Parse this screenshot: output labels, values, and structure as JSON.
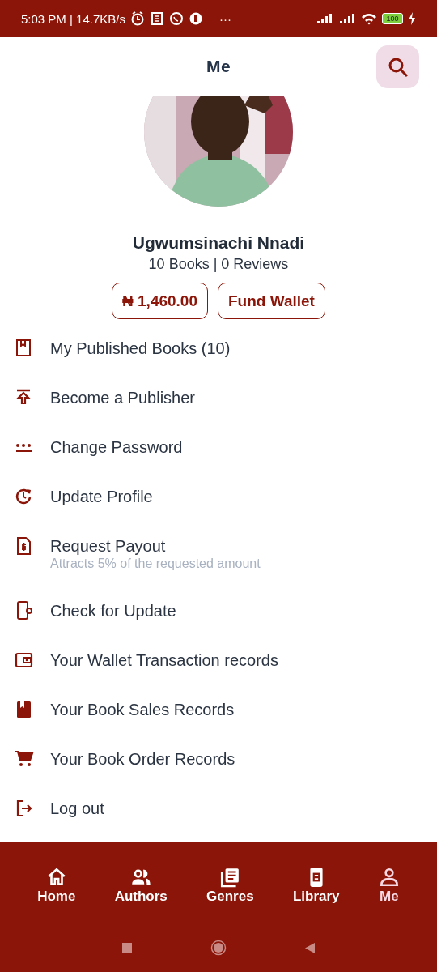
{
  "status_bar": {
    "time": "5:03 PM | 14.7KB/s",
    "more": "···",
    "battery": "100"
  },
  "header": {
    "title": "Me"
  },
  "profile": {
    "name": "Ugwumsinachi Nnadi",
    "stats": "10 Books | 0 Reviews",
    "balance": "₦ 1,460.00",
    "fund_button": "Fund Wallet"
  },
  "menu": [
    {
      "label": "My Published Books (10)"
    },
    {
      "label": "Become a Publisher"
    },
    {
      "label": "Change Password"
    },
    {
      "label": "Update Profile"
    },
    {
      "label": "Request Payout",
      "subtitle": "Attracts 5% of the requested amount"
    },
    {
      "label": "Check for Update"
    },
    {
      "label": "Your Wallet Transaction records"
    },
    {
      "label": "Your Book Sales Records"
    },
    {
      "label": "Your Book Order Records"
    },
    {
      "label": "Log out"
    }
  ],
  "bottom_nav": [
    {
      "label": "Home",
      "selected": false
    },
    {
      "label": "Authors",
      "selected": false
    },
    {
      "label": "Genres",
      "selected": false
    },
    {
      "label": "Library",
      "selected": false
    },
    {
      "label": "Me",
      "selected": true
    }
  ]
}
